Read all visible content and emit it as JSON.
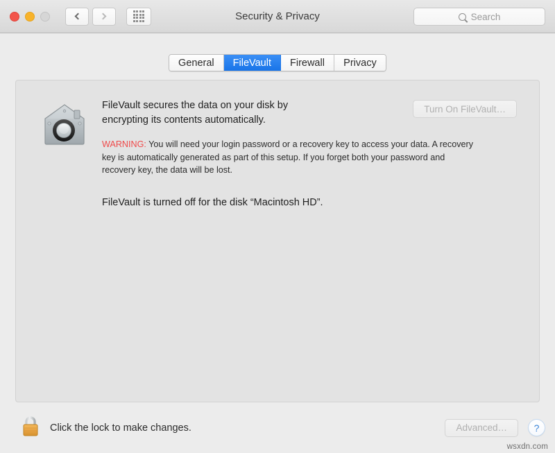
{
  "window": {
    "title": "Security & Privacy",
    "traffic_lights": [
      {
        "name": "close",
        "color": "#f2554b"
      },
      {
        "name": "minimize",
        "color": "#f8b32b"
      },
      {
        "name": "zoom",
        "color": "#d6d6d6"
      }
    ],
    "nav": {
      "back_label": "Back",
      "forward_label": "Forward",
      "show_all_label": "Show All"
    },
    "search": {
      "placeholder": "Search",
      "value": ""
    }
  },
  "tabs": [
    {
      "label": "General",
      "active": false
    },
    {
      "label": "FileVault",
      "active": true
    },
    {
      "label": "Firewall",
      "active": false
    },
    {
      "label": "Privacy",
      "active": false
    }
  ],
  "filevault": {
    "icon_name": "filevault-house-safe-icon",
    "description": "FileVault secures the data on your disk by encrypting its contents automatically.",
    "turn_on_button": "Turn On FileVault…",
    "turn_on_enabled": false,
    "warning_label": "WARNING:",
    "warning_text": " You will need your login password or a recovery key to access your data. A recovery key is automatically generated as part of this setup. If you forget both your password and recovery key, the data will be lost.",
    "status": "FileVault is turned off for the disk “Macintosh HD”."
  },
  "bottom": {
    "lock_state": "locked",
    "lock_text": "Click the lock to make changes.",
    "advanced_button": "Advanced…",
    "advanced_enabled": false,
    "help_button": "?"
  },
  "watermark": "wsxdn.com",
  "colors": {
    "accent_blue": "#1874e8",
    "warning_red": "#ef4a4a",
    "help_blue": "#3a84d6",
    "window_bg": "#ececec",
    "panel_bg": "#e3e3e3"
  }
}
